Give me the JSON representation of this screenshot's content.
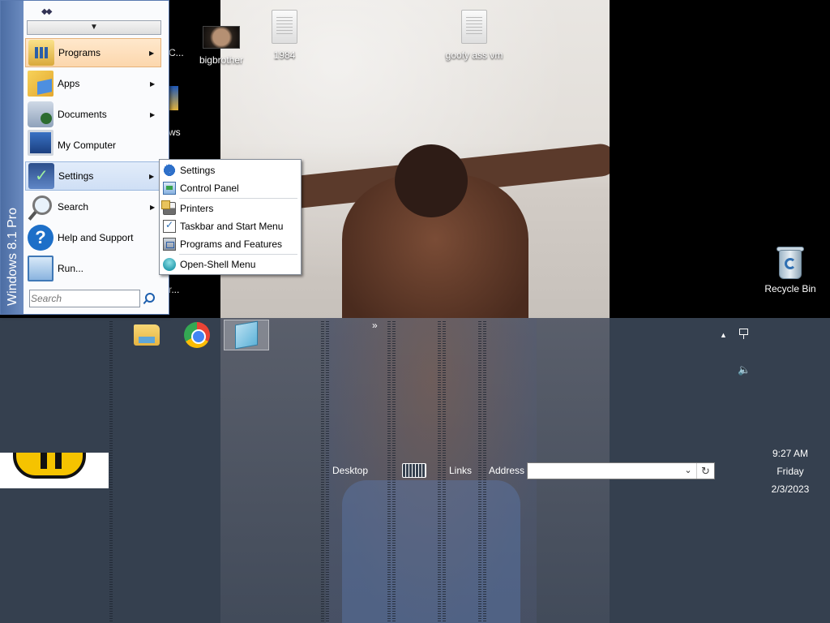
{
  "desktop": {
    "icons": [
      {
        "name": "bigbrother",
        "label": "bigbrother"
      },
      {
        "name": "1984",
        "label": "1984"
      },
      {
        "name": "goofy-ass-vm",
        "label": "goofy ass vm"
      },
      {
        "name": "recycle-bin",
        "label": "Recycle Bin"
      }
    ],
    "partial_labels": {
      "c": "C...",
      "ws": "ws",
      "r": "-r..."
    }
  },
  "start_menu": {
    "banner": "Windows 8.1 Pro",
    "items": [
      {
        "label": "Programs",
        "icon": "programs-icon",
        "has_submenu": true
      },
      {
        "label": "Apps",
        "icon": "apps-icon",
        "has_submenu": true
      },
      {
        "label": "Documents",
        "icon": "documents-icon",
        "has_submenu": true
      },
      {
        "label": "My Computer",
        "icon": "computer-icon",
        "has_submenu": false
      },
      {
        "label": "Settings",
        "icon": "settings-icon",
        "has_submenu": true
      },
      {
        "label": "Search",
        "icon": "search-icon",
        "has_submenu": true
      },
      {
        "label": "Help and Support",
        "icon": "help-icon",
        "has_submenu": false
      },
      {
        "label": "Run...",
        "icon": "run-icon",
        "has_submenu": false
      }
    ],
    "search_placeholder": "Search"
  },
  "settings_submenu": {
    "items": [
      {
        "label": "Settings",
        "icon": "gear-icon"
      },
      {
        "label": "Control Panel",
        "icon": "control-panel-icon"
      },
      {
        "label": "Printers",
        "icon": "printer-icon"
      },
      {
        "label": "Taskbar and Start Menu",
        "icon": "taskbar-icon"
      },
      {
        "label": "Programs and Features",
        "icon": "programs-features-icon"
      },
      {
        "label": "Open-Shell Menu",
        "icon": "open-shell-icon"
      }
    ]
  },
  "taskbar": {
    "toolbar_more": "»",
    "desktop_label": "Desktop",
    "links_label": "Links",
    "address_label": "Address",
    "address_value": "",
    "clock": {
      "time": "9:27 AM",
      "day": "Friday",
      "date": "2/3/2023"
    }
  }
}
